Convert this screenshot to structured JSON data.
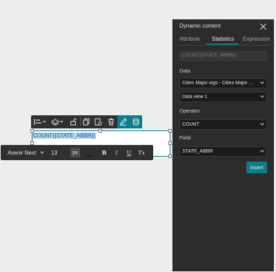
{
  "canvas": {
    "text_widget": {
      "content": "COUNT({STATE_ABBR})"
    }
  },
  "format_toolbar": {
    "font_family": "Avenir Next",
    "font_size": "13",
    "unit": "px",
    "bold": "B",
    "italic": "I",
    "underline": "U",
    "clear_format": "Tx"
  },
  "panel": {
    "title": "Dynamic content",
    "tabs": [
      {
        "label": "Attribute",
        "active": false
      },
      {
        "label": "Statistics",
        "active": true
      },
      {
        "label": "Expression",
        "active": false
      }
    ],
    "expression_preview": "COUNT({STATE_ABBR})",
    "data_label": "Data",
    "data_source": "Cities Major wgs - Cities Major ...",
    "data_view": "Data view 1",
    "operator_label": "Operator",
    "operator_value": "COUNT",
    "field_label": "Field",
    "field_value": "STATE_ABBR",
    "insert_label": "Insert"
  },
  "colors": {
    "accent": "#0a7e8c",
    "panel_bg": "#2c2c2c",
    "canvas_bg": "#ededed"
  }
}
